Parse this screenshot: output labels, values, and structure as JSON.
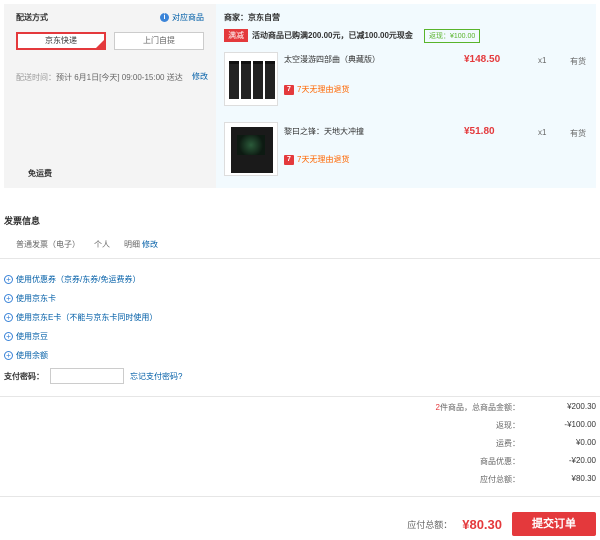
{
  "shipping": {
    "title": "配送方式",
    "gift_link": "对应商品",
    "options": [
      "京东快递",
      "上门自提"
    ],
    "time_label": "配送时间：",
    "time_value": "预计 6月1日[今天] 09:00-15:00 送达",
    "edit": "修改",
    "free_ship": "免运费"
  },
  "order": {
    "seller": "商家：京东自营",
    "promo_tag": "满减",
    "promo_text": "活动商品已购满200.00元，已减100.00元现金",
    "rebate": "返现：¥100.00",
    "items": [
      {
        "name": "太空漫游四部曲（典藏版）",
        "price": "¥148.50",
        "qty": "x1",
        "stock": "有货",
        "return_policy": "7天无理由退货"
      },
      {
        "name": "黎曰之锋：天地大冲撞",
        "price": "¥51.80",
        "qty": "x1",
        "stock": "有货",
        "return_policy": "7天无理由退货"
      }
    ]
  },
  "invoice": {
    "title": "发票信息",
    "type": "普通发票（电子）",
    "holder": "个人",
    "content": "明细",
    "edit": "修改"
  },
  "discounts": [
    "使用优惠券（京券/东券/免运费券）",
    "使用京东卡",
    "使用京东E卡（不能与京东卡同时使用）",
    "使用京豆",
    "使用余额"
  ],
  "payment": {
    "password_label": "支付密码：",
    "forgot": "忘记支付密码?"
  },
  "summary": {
    "count": "2",
    "count_suffix": "件商品，总商品金额：",
    "rows": [
      {
        "label": "返现：",
        "value": "-¥100.00"
      },
      {
        "label": "运费：",
        "value": "¥0.00"
      },
      {
        "label": "商品优惠：",
        "value": "-¥20.00"
      },
      {
        "label": "应付总额：",
        "value": "¥80.30"
      }
    ],
    "goods_total": "¥200.30",
    "total_label": "应付总额：",
    "total_value": "¥80.30",
    "submit": "提交订单"
  },
  "colors": {
    "accent": "#e4393c",
    "link": "#005ea7",
    "orange": "#ff6600",
    "green": "#59b42b"
  }
}
